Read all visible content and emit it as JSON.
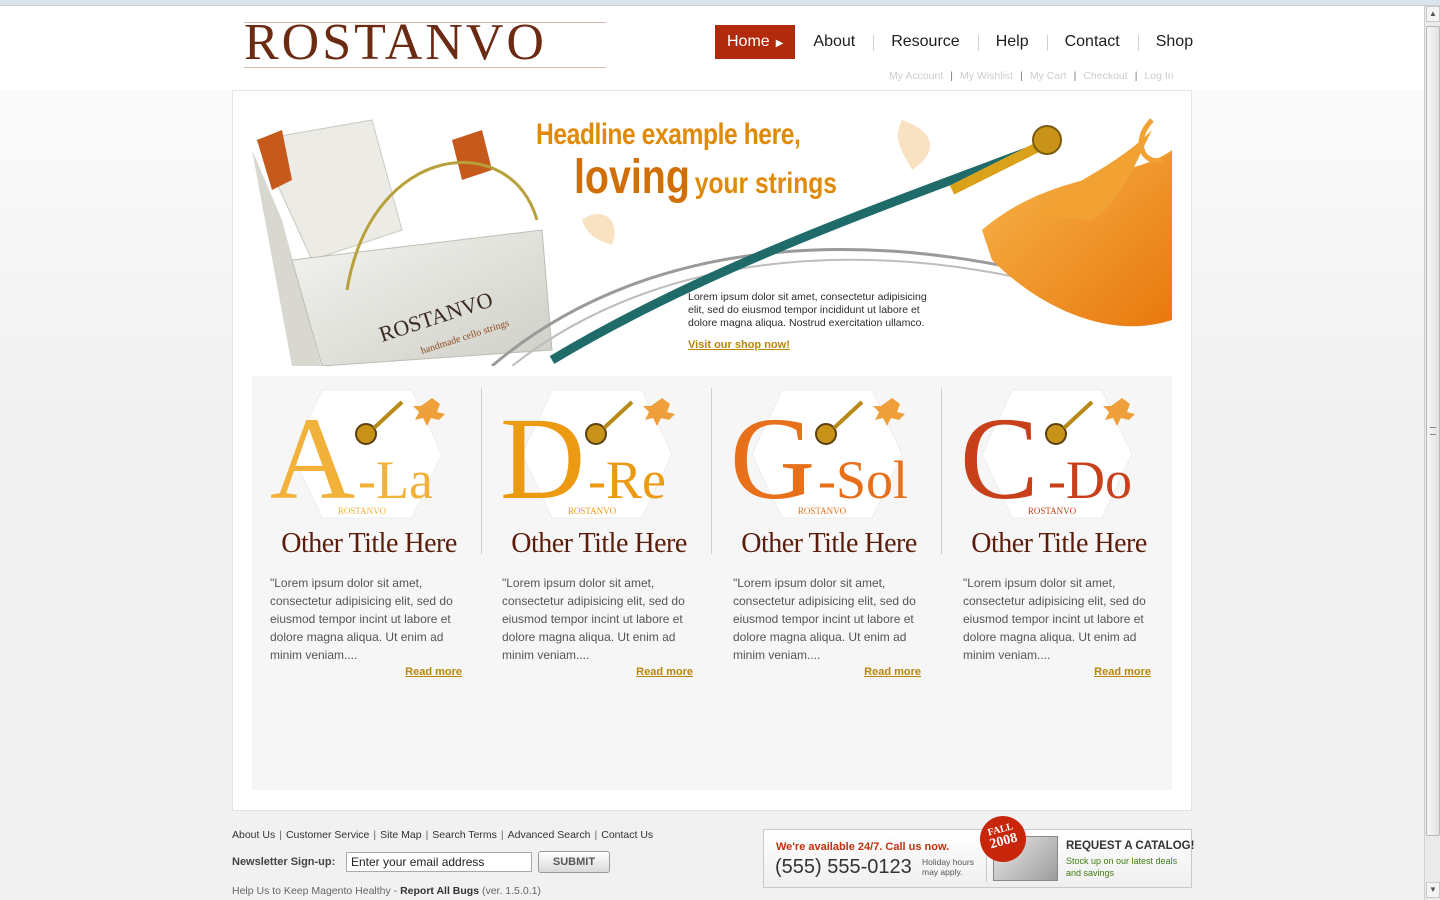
{
  "brand": {
    "logo_text": "ROSTANVO"
  },
  "nav": {
    "items": [
      {
        "label": "Home",
        "active": true
      },
      {
        "label": "About"
      },
      {
        "label": "Resource"
      },
      {
        "label": "Help"
      },
      {
        "label": "Contact"
      },
      {
        "label": "Shop"
      }
    ]
  },
  "account_links": [
    "My Account",
    "My Wishlist",
    "My Cart",
    "Checkout",
    "Log In"
  ],
  "banner": {
    "headline_line1": "Headline example here,",
    "headline_big": "loving",
    "headline_small": "your strings",
    "box_brand": "ROSTANVO",
    "box_tagline": "handmade cello strings",
    "body": "Lorem ipsum dolor sit amet, consectetur adipisicing elit, sed do eiusmod tempor incididunt ut labore et dolore magna aliqua. Nostrud exercitation ullamco.",
    "link": "Visit our shop now!"
  },
  "cards": [
    {
      "letter": "A",
      "suffix": "-La",
      "brand": "ROSTANVO",
      "color": "#f2b23a",
      "title": "Other Title Here",
      "text": "\"Lorem ipsum dolor sit amet, consectetur adipisicing elit, sed do eiusmod tempor incint ut labore et dolore magna aliqua. Ut enim ad minim veniam....",
      "more": "Read more"
    },
    {
      "letter": "D",
      "suffix": "-Re",
      "brand": "ROSTANVO",
      "color": "#eb9a12",
      "title": "Other Title Here",
      "text": "\"Lorem ipsum dolor sit amet, consectetur adipisicing elit, sed do eiusmod tempor incint ut labore et dolore magna aliqua. Ut enim ad minim veniam....",
      "more": "Read more"
    },
    {
      "letter": "G",
      "suffix": "-Sol",
      "brand": "ROSTANVO",
      "color": "#e8701a",
      "title": "Other Title Here",
      "text": "\"Lorem ipsum dolor sit amet, consectetur adipisicing elit, sed do eiusmod tempor incint ut labore et dolore magna aliqua. Ut enim ad minim veniam....",
      "more": "Read more"
    },
    {
      "letter": "C",
      "suffix": "-Do",
      "brand": "ROSTANVO",
      "color": "#c8401a",
      "title": "Other Title Here",
      "text": "\"Lorem ipsum dolor sit amet, consectetur adipisicing elit, sed do eiusmod tempor incint ut labore et dolore magna aliqua. Ut enim ad minim veniam....",
      "more": "Read more"
    }
  ],
  "footer": {
    "links": [
      "About Us",
      "Customer Service",
      "Site Map",
      "Search Terms",
      "Advanced Search",
      "Contact Us"
    ],
    "newsletter_label": "Newsletter Sign-up:",
    "newsletter_value": "Enter your email address",
    "submit_label": "SUBMIT",
    "help_prefix": "Help Us to Keep Magento Healthy - ",
    "help_link": "Report All Bugs",
    "help_version": " (ver. 1.5.0.1)"
  },
  "callout": {
    "availability": "We're available 24/7. Call us now.",
    "phone": "(555) 555-0123",
    "hours_line1": "Holiday hours",
    "hours_line2": "may apply.",
    "badge_line1": "FALL",
    "badge_line2": "2008",
    "catalog_title": "REQUEST A CATALOG!",
    "catalog_sub": "Stock up on our latest deals and savings"
  },
  "colors": {
    "nav_active": "#b12a0c",
    "accent_orange": "#e08a0a",
    "link_gold": "#b8860b",
    "title_brown": "#5b1d0a"
  }
}
